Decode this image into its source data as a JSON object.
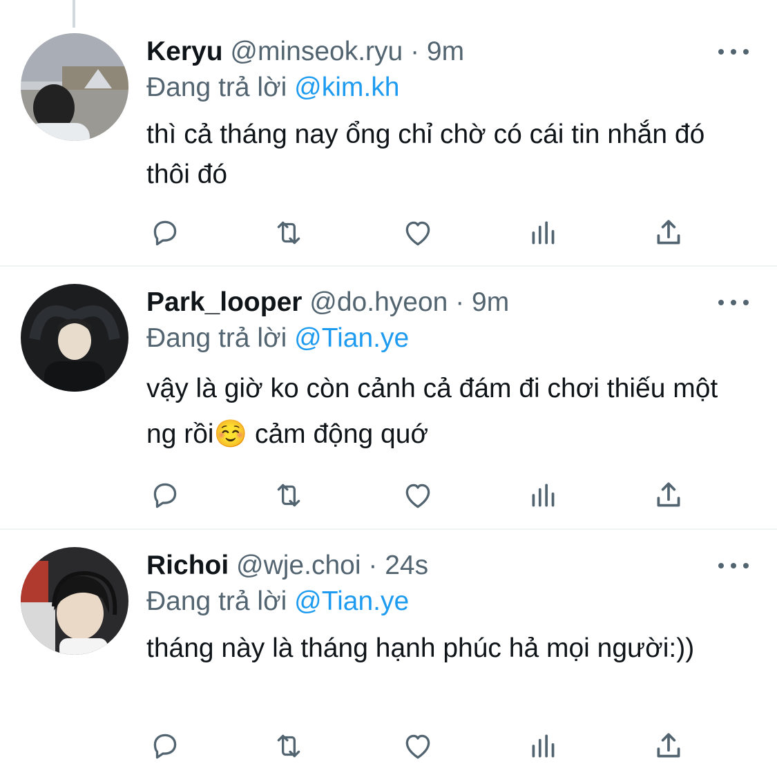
{
  "tweets": [
    {
      "name": "Keryu",
      "handle": "@minseok.ryu",
      "dot": "·",
      "time": "9m",
      "reply_prefix": "Đang trả lời",
      "reply_to": "@kim.kh",
      "text": "thì cả tháng nay ổng chỉ chờ có cái tin nhắn đó thôi đó"
    },
    {
      "name": "Park_looper",
      "handle": "@do.hyeon",
      "dot": "·",
      "time": "9m",
      "reply_prefix": "Đang trả lời",
      "reply_to": "@Tian.ye",
      "text": "vậy là giờ ko còn cảnh cả đám đi chơi thiếu một ng rồi☺️ cảm động quớ"
    },
    {
      "name": "Richoi",
      "handle": "@wje.choi",
      "dot": "·",
      "time": "24s",
      "reply_prefix": "Đang trả lời",
      "reply_to": "@Tian.ye",
      "text": "tháng này là tháng hạnh phúc hả mọi người:))"
    }
  ],
  "colors": {
    "text": "#0f1419",
    "secondary": "#536471",
    "mention": "#1d9bf0",
    "divider": "#eff3f4"
  },
  "icons": [
    "reply-icon",
    "retweet-icon",
    "like-icon",
    "views-icon",
    "share-icon",
    "more-icon"
  ]
}
